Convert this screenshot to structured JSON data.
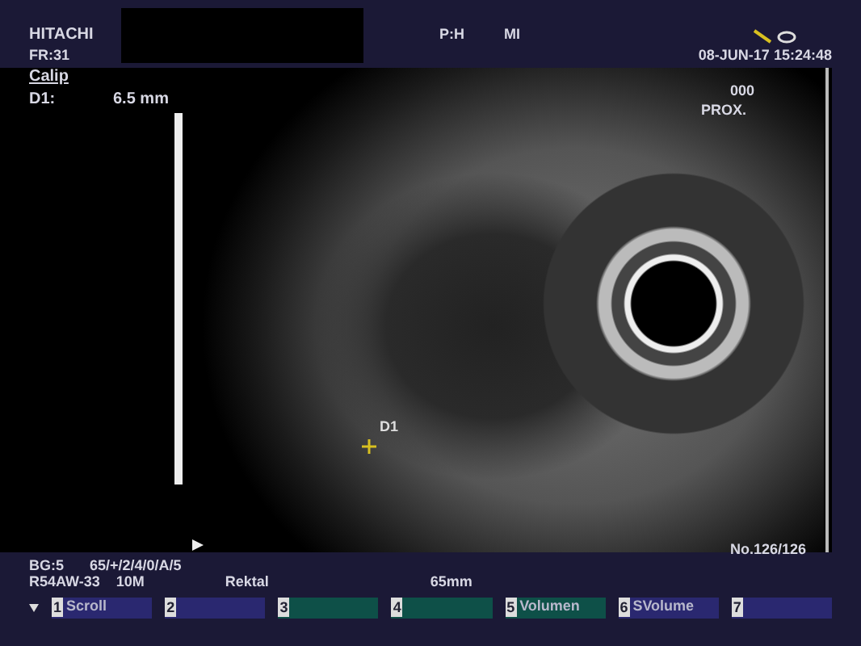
{
  "header": {
    "brand": "HITACHI",
    "frame_rate": "FR:31",
    "power": "P:H",
    "index": "MI",
    "date": "08-JUN-17",
    "time": "15:24:48"
  },
  "image": {
    "tool": "Calip",
    "measurement_label": "D1:",
    "measurement_value": "6.5 mm",
    "caliper_label": "D1",
    "position_code": "000",
    "position": "PROX.",
    "frame_counter": "No.126/126"
  },
  "info": {
    "line_1": [
      "BG:5",
      "65/+/2/4/0/A/5"
    ],
    "line_2": [
      "R54AW-33",
      "10M",
      "Rektal",
      "65mm"
    ]
  },
  "soft_keys": [
    {
      "number": "1",
      "label": "Scroll",
      "color": "#2a2870"
    },
    {
      "number": "2",
      "color": "#2a2870"
    },
    {
      "number": "3",
      "color": "#0e5048"
    },
    {
      "number": "4",
      "color": "#0e5048"
    },
    {
      "number": "5",
      "label": "Volumen",
      "color": "#0e5048"
    },
    {
      "number": "6",
      "label": "SVolume",
      "color": "#2a2870"
    },
    {
      "number": "7",
      "color": "#2a2870"
    }
  ]
}
